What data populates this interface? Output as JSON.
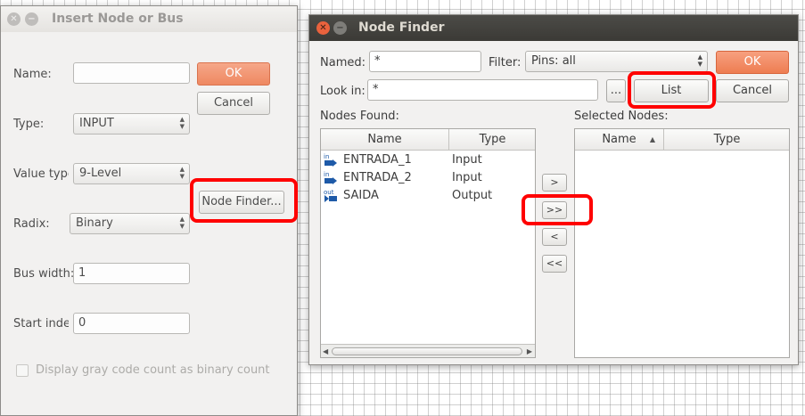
{
  "insert_dialog": {
    "title": "Insert Node or Bus",
    "name_label": "Name:",
    "name_value": "",
    "ok_label": "OK",
    "cancel_label": "Cancel",
    "type_label": "Type:",
    "type_value": "INPUT",
    "value_type_label": "Value type:",
    "value_type_value": "9-Level",
    "node_finder_label": "Node Finder...",
    "radix_label": "Radix:",
    "radix_value": "Binary",
    "bus_width_label": "Bus width:",
    "bus_width_value": "1",
    "start_index_label": "Start index:",
    "start_index_value": "0",
    "gray_code_label": "Display gray code count as binary count"
  },
  "node_finder": {
    "title": "Node Finder",
    "named_label": "Named:",
    "named_value": "*",
    "filter_label": "Filter:",
    "filter_value": "Pins: all",
    "ok_label": "OK",
    "look_in_label": "Look in:",
    "look_in_value": "*",
    "browse_label": "...",
    "list_label": "List",
    "cancel_label": "Cancel",
    "nodes_found_label": "Nodes Found:",
    "selected_nodes_label": "Selected Nodes:",
    "nodes_found_columns": [
      "Name",
      "Type"
    ],
    "selected_columns": [
      "Name",
      "Type"
    ],
    "nodes": [
      {
        "icon": "in",
        "name": "ENTRADA_1",
        "type": "Input"
      },
      {
        "icon": "in",
        "name": "ENTRADA_2",
        "type": "Input"
      },
      {
        "icon": "out",
        "name": "SAIDA",
        "type": "Output"
      }
    ],
    "move_buttons": [
      ">",
      ">>",
      "<",
      "<<"
    ]
  },
  "colors": {
    "highlight": "#ff0000",
    "ok_accent": "#ee7d52",
    "titlebar_active": "#3b3a36",
    "pin_icon": "#1e5aa8"
  },
  "icons": [
    "close-icon",
    "minimize-icon",
    "input-pin-icon",
    "output-pin-icon",
    "sort-ascending-icon"
  ]
}
